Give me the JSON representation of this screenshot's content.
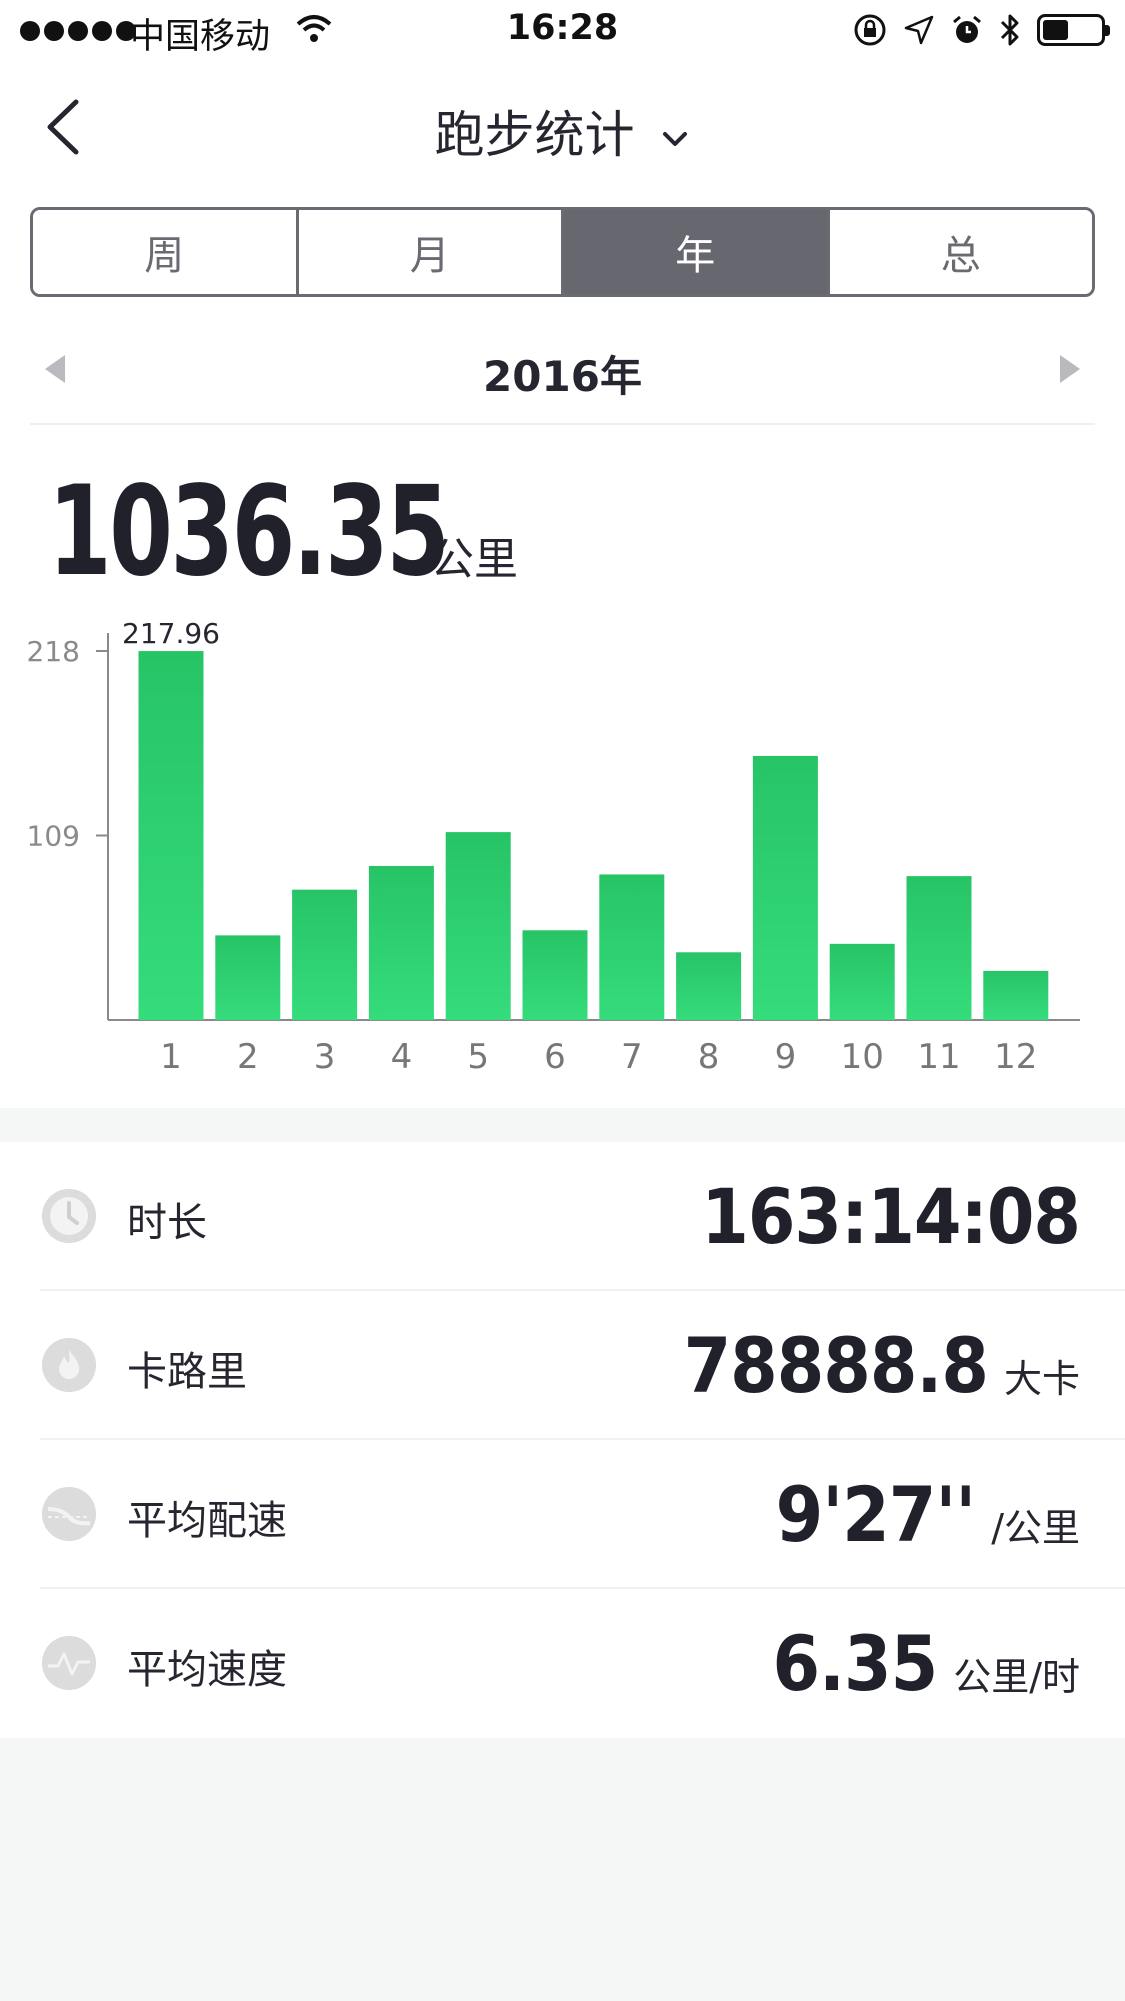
{
  "status_bar": {
    "carrier": "中国移动",
    "time": "16:28",
    "battery_level": 0.45
  },
  "nav": {
    "title": "跑步统计"
  },
  "segments": [
    {
      "label": "周",
      "active": false
    },
    {
      "label": "月",
      "active": false
    },
    {
      "label": "年",
      "active": true
    },
    {
      "label": "总",
      "active": false
    }
  ],
  "period": {
    "label": "2016年"
  },
  "summary": {
    "value": "1036.35",
    "unit": "公里"
  },
  "chart_data": {
    "type": "bar",
    "categories": [
      "1",
      "2",
      "3",
      "4",
      "5",
      "6",
      "7",
      "8",
      "9",
      "10",
      "11",
      "12"
    ],
    "values": [
      217.96,
      50,
      77,
      91,
      111,
      53,
      86,
      40,
      156,
      45,
      85,
      29
    ],
    "ylim": [
      0,
      218
    ],
    "yticks": [
      109,
      218
    ],
    "ytick_labels": [
      "109",
      "218"
    ],
    "max_label": "217.96",
    "bar_color": "#2ecc71",
    "grid": false
  },
  "stats": [
    {
      "icon": "clock-icon",
      "label": "时长",
      "value": "163:14:08",
      "unit": ""
    },
    {
      "icon": "flame-icon",
      "label": "卡路里",
      "value": "78888.8",
      "unit": "大卡"
    },
    {
      "icon": "pace-icon",
      "label": "平均配速",
      "value": "9'27''",
      "unit": "/公里"
    },
    {
      "icon": "speed-icon",
      "label": "平均速度",
      "value": "6.35",
      "unit": "公里/时"
    }
  ]
}
